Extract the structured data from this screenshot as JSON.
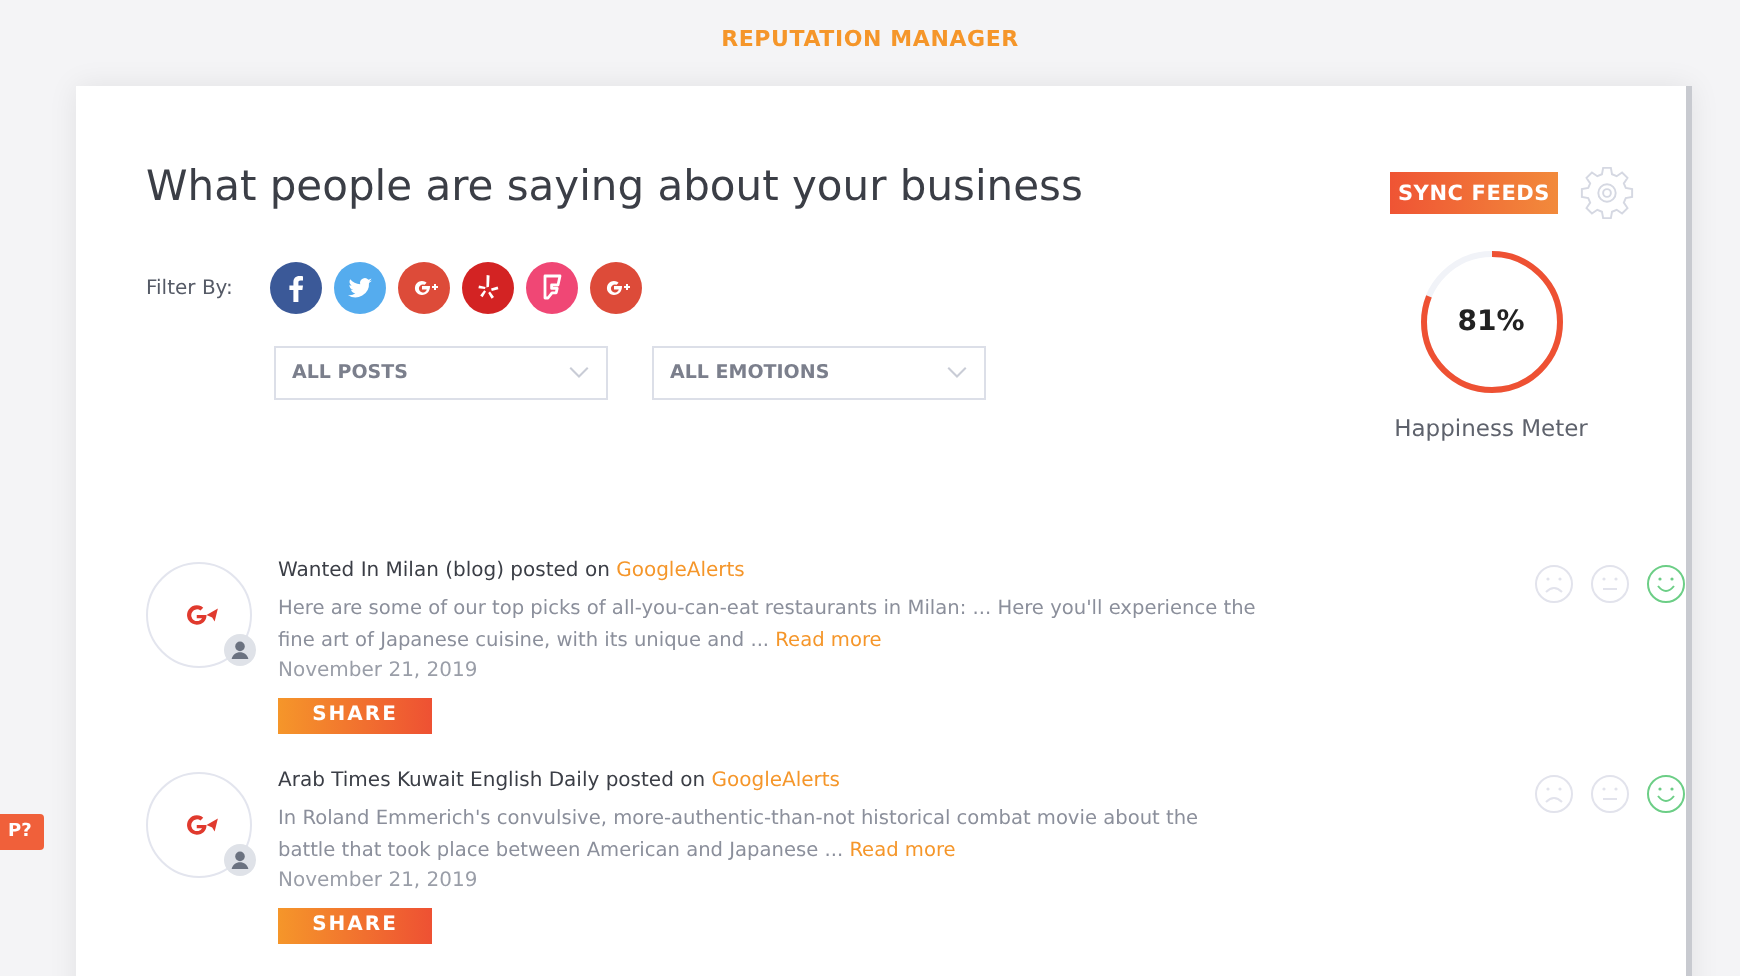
{
  "app_title": "REPUTATION MANAGER",
  "help_tab": "P?",
  "heading": "What people are saying about your business",
  "sync_button": "SYNC FEEDS",
  "filter": {
    "label": "Filter By:",
    "sources": [
      {
        "kind": "facebook",
        "color": "#3b5998"
      },
      {
        "kind": "twitter",
        "color": "#55acee"
      },
      {
        "kind": "gplus",
        "color": "#dd4b39"
      },
      {
        "kind": "yelp",
        "color": "#d32323"
      },
      {
        "kind": "foursquare",
        "color": "#f04775"
      },
      {
        "kind": "galerts",
        "color": "#dd4b39"
      }
    ]
  },
  "dropdowns": [
    "ALL POSTS",
    "ALL EMOTIONS"
  ],
  "meter": {
    "value": "81%",
    "level": 0.81,
    "label": "Happiness Meter"
  },
  "posts": [
    {
      "author": "Wanted In Milan (blog) posted on ",
      "source": "GoogleAlerts",
      "text": "Here are some of our top picks of all-you-can-eat restaurants in Milan: ... Here you'll experience the fine art of Japanese cuisine, with its unique and ... ",
      "read_more": "Read more",
      "date": "November 21, 2019",
      "share": "SHARE",
      "emotions": [
        {
          "kind": "sad",
          "selected": false
        },
        {
          "kind": "neutral",
          "selected": false
        },
        {
          "kind": "happy",
          "selected": true
        }
      ]
    },
    {
      "author": "Arab Times Kuwait English Daily posted on ",
      "source": "GoogleAlerts",
      "text": "In Roland Emmerich's convulsive, more-authentic-than-not historical combat movie about the battle that took place between American and Japanese ... ",
      "read_more": "Read more",
      "date": "November 21, 2019",
      "share": "SHARE",
      "emotions": [
        {
          "kind": "sad",
          "selected": false
        },
        {
          "kind": "neutral",
          "selected": false
        },
        {
          "kind": "happy",
          "selected": true
        }
      ]
    }
  ]
}
